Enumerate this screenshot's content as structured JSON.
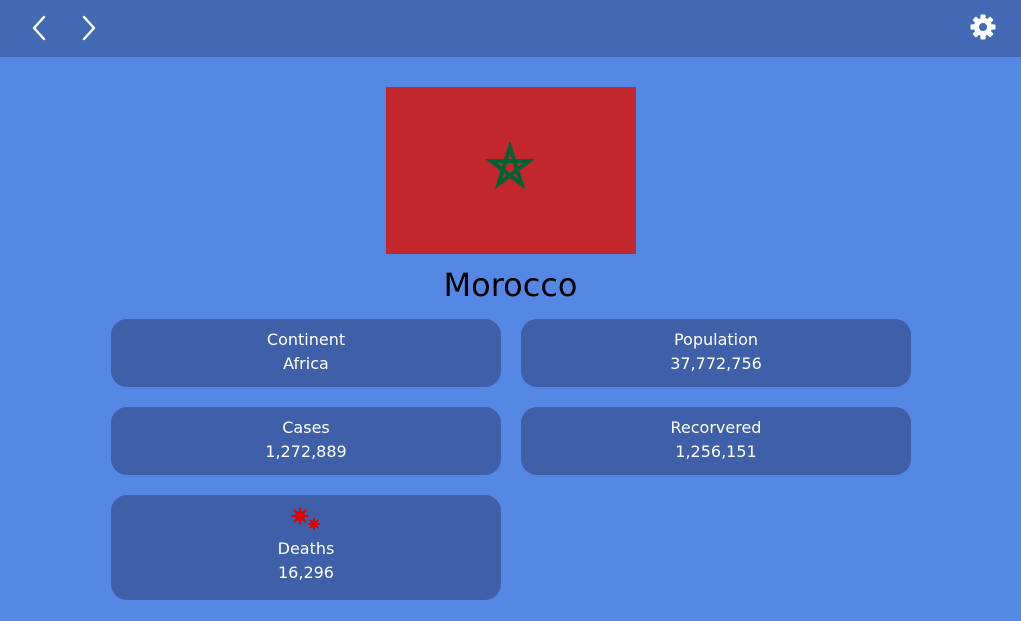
{
  "header": {
    "back_icon": "chevron-left-icon",
    "forward_icon": "chevron-right-icon",
    "settings_icon": "gear-icon"
  },
  "country": {
    "name": "Morocco",
    "flag": {
      "background": "#c1272d",
      "star_color": "#006233"
    }
  },
  "stats": {
    "continent": {
      "label": "Continent",
      "value": "Africa"
    },
    "population": {
      "label": "Population",
      "value": "37,772,756"
    },
    "cases": {
      "label": "Cases",
      "value": "1,272,889"
    },
    "recovered": {
      "label": "Recorvered",
      "value": "1,256,151"
    },
    "deaths": {
      "label": "Deaths",
      "value": "16,296",
      "icon": "virus-icon"
    }
  },
  "colors": {
    "background": "#5488e4",
    "header": "#4369b4",
    "card": "#3f5fa8",
    "virus": "#e00000"
  }
}
